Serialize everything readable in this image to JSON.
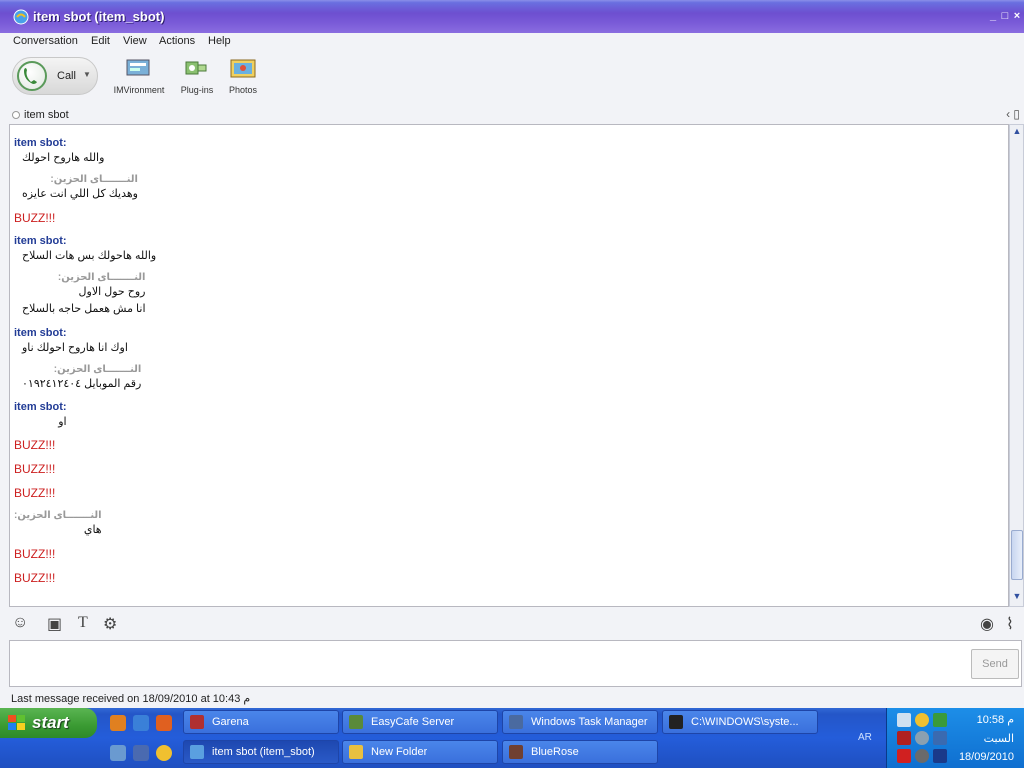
{
  "window": {
    "title": "item sbot (item_sbot)",
    "controls": [
      "_",
      "□",
      "×"
    ]
  },
  "menu": [
    "Conversation",
    "Edit",
    "View",
    "Actions",
    "Help"
  ],
  "toolbar": {
    "call_label": "Call",
    "tools": [
      {
        "label": "IMVironment",
        "icon": "imvironment-icon"
      },
      {
        "label": "Plug-ins",
        "icon": "plugins-icon"
      },
      {
        "label": "Photos",
        "icon": "photos-icon"
      }
    ]
  },
  "contact": {
    "name": "item sbot"
  },
  "messages": [
    {
      "type": "item",
      "sender": "item sbot:",
      "lines": [
        "والله هاروح احولك"
      ]
    },
    {
      "type": "other",
      "sender": "النـــــــاى الحزين:",
      "lines": [
        "وهديك كل اللي انت عايزه"
      ]
    },
    {
      "type": "buzz",
      "text": "BUZZ!!!"
    },
    {
      "type": "item",
      "sender": "item sbot:",
      "lines": [
        "والله هاحولك بس هات السلاح"
      ]
    },
    {
      "type": "other",
      "sender": "النـــــــاى الحزين:",
      "lines": [
        "روح حول الاول",
        "انا مش هعمل حاجه بالسلاح"
      ]
    },
    {
      "type": "item",
      "sender": "item sbot:",
      "lines": [
        "اوك انا هاروح احولك ناو"
      ]
    },
    {
      "type": "other",
      "sender": "النـــــــاى الحزين:",
      "lines": [
        "رقم الموبايل ٠١٩٢٤١٢٤٠٤"
      ]
    },
    {
      "type": "item",
      "sender": "item sbot:",
      "lines": [
        "او"
      ]
    },
    {
      "type": "buzz",
      "text": "BUZZ!!!"
    },
    {
      "type": "buzz",
      "text": "BUZZ!!!"
    },
    {
      "type": "buzz",
      "text": "BUZZ!!!"
    },
    {
      "type": "other",
      "sender": "النـــــــاى الحزين:",
      "lines": [
        "هاي"
      ]
    },
    {
      "type": "buzz",
      "text": "BUZZ!!!"
    },
    {
      "type": "buzz",
      "text": "BUZZ!!!"
    }
  ],
  "input": {
    "value": "",
    "send_label": "Send"
  },
  "status": {
    "text": "Last message received on 18/09/2010 at 10:43 م"
  },
  "taskbar": {
    "start_label": "start",
    "row1": [
      {
        "label": "Garena",
        "icon_color": "#b03030"
      },
      {
        "label": "EasyCafe Server",
        "icon_color": "#5a8a3a"
      },
      {
        "label": "Windows Task Manager",
        "icon_color": "#4a6aa0"
      },
      {
        "label": "C:\\WINDOWS\\syste...",
        "icon_color": "#222222"
      }
    ],
    "row2": [
      {
        "label": "item sbot (item_sbot)",
        "icon_color": "#5aa0e0",
        "active": true
      },
      {
        "label": "New Folder",
        "icon_color": "#e8c040"
      },
      {
        "label": "BlueRose",
        "icon_color": "#704030"
      }
    ],
    "lang": "AR",
    "clock": {
      "time": "10:58 م",
      "day": "السبت",
      "date": "18/09/2010"
    }
  },
  "colors": {
    "sender_item": "#223c96",
    "sender_other": "#999999",
    "buzz": "#cc1f1f"
  }
}
